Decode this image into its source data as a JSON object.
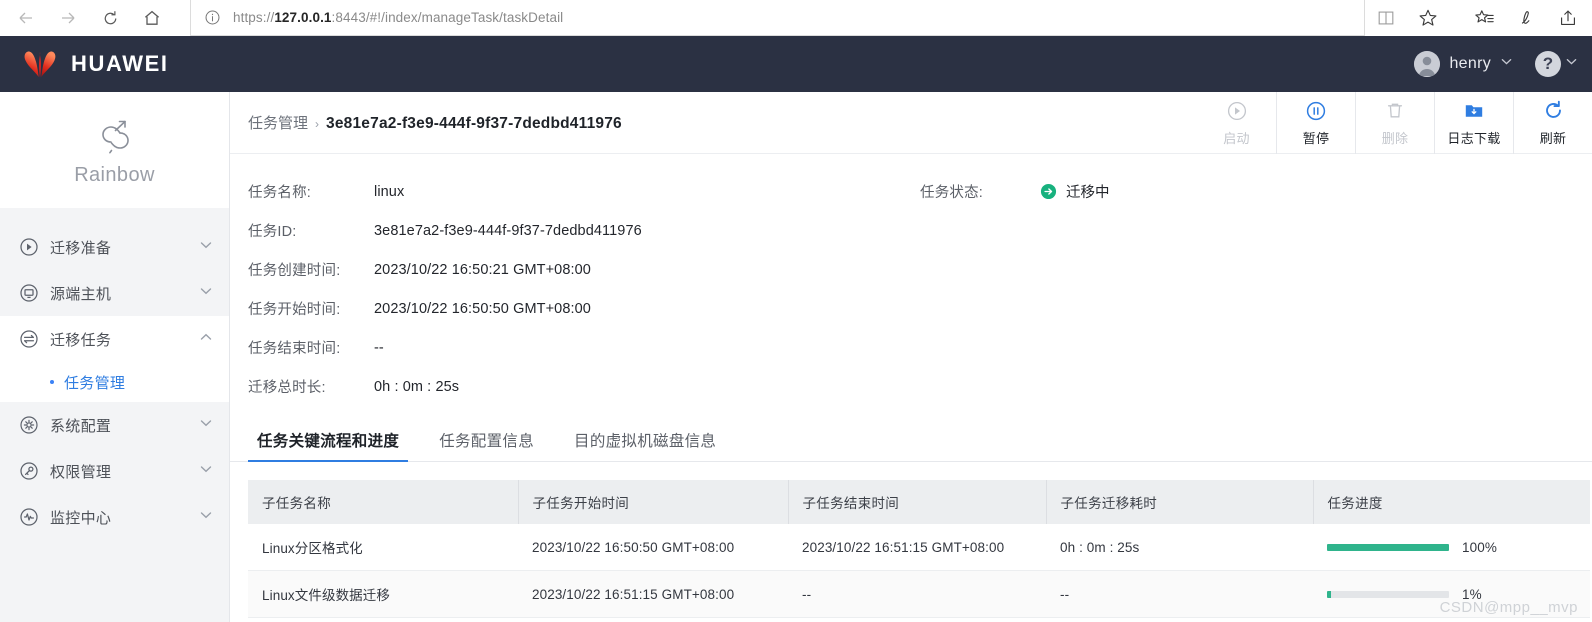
{
  "browser": {
    "nav": [
      {
        "name": "back",
        "icon": "arrow-left-icon",
        "enabled": false
      },
      {
        "name": "forward",
        "icon": "arrow-right-icon",
        "enabled": false
      },
      {
        "name": "refresh",
        "icon": "reload-icon",
        "enabled": true
      },
      {
        "name": "home",
        "icon": "home-icon",
        "enabled": true
      }
    ],
    "url_scheme": "https://",
    "url_host": "127.0.0.1",
    "url_path": ":8443/#!/index/manageTask/taskDetail",
    "url_full": "https://127.0.0.1:8443/#!/index/manageTask/taskDetail",
    "toolbar_icons": [
      "reading-view-icon",
      "favorite-star-icon",
      "reading-list-icon",
      "ink-pen-icon",
      "share-icon"
    ]
  },
  "header": {
    "brand": "HUAWEI",
    "user": "henry",
    "help_label": "?"
  },
  "sidebar": {
    "product": "Rainbow",
    "items": [
      {
        "label": "迁移准备",
        "icon": "play-circle-icon",
        "expanded": false
      },
      {
        "label": "源端主机",
        "icon": "monitor-circle-icon",
        "expanded": false
      },
      {
        "label": "迁移任务",
        "icon": "transfer-circle-icon",
        "expanded": true,
        "children": [
          {
            "label": "任务管理",
            "active": true
          }
        ]
      },
      {
        "label": "系统配置",
        "icon": "gear-circle-icon",
        "expanded": false
      },
      {
        "label": "权限管理",
        "icon": "key-circle-icon",
        "expanded": false
      },
      {
        "label": "监控中心",
        "icon": "pulse-circle-icon",
        "expanded": false
      }
    ]
  },
  "breadcrumb": {
    "parent": "任务管理",
    "separator": "›",
    "current": "3e81e7a2-f3e9-444f-9f37-7dedbd411976"
  },
  "actions": [
    {
      "label": "启动",
      "icon": "play-circle-icon",
      "enabled": false
    },
    {
      "label": "暂停",
      "icon": "pause-circle-icon",
      "enabled": true
    },
    {
      "label": "删除",
      "icon": "trash-icon",
      "enabled": false
    },
    {
      "label": "日志下载",
      "icon": "folder-download-icon",
      "enabled": true
    },
    {
      "label": "刷新",
      "icon": "refresh-icon",
      "enabled": true
    }
  ],
  "detail": {
    "fields": [
      {
        "label": "任务名称:",
        "value": "linux"
      },
      {
        "label": "任务ID:",
        "value": "3e81e7a2-f3e9-444f-9f37-7dedbd411976"
      },
      {
        "label": "任务创建时间:",
        "value": "2023/10/22 16:50:21 GMT+08:00"
      },
      {
        "label": "任务开始时间:",
        "value": "2023/10/22 16:50:50 GMT+08:00"
      },
      {
        "label": "任务结束时间:",
        "value": "--"
      },
      {
        "label": "迁移总时长:",
        "value": "0h : 0m : 25s"
      }
    ],
    "status_label": "任务状态:",
    "status_value": "迁移中",
    "status_color": "#18b17e"
  },
  "tabs": [
    {
      "label": "任务关键流程和进度",
      "active": true
    },
    {
      "label": "任务配置信息",
      "active": false
    },
    {
      "label": "目的虚拟机磁盘信息",
      "active": false
    }
  ],
  "table": {
    "columns": [
      "子任务名称",
      "子任务开始时间",
      "子任务结束时间",
      "子任务迁移耗时",
      "任务进度"
    ],
    "rows": [
      {
        "name": "Linux分区格式化",
        "start": "2023/10/22 16:50:50 GMT+08:00",
        "end": "2023/10/22 16:51:15 GMT+08:00",
        "elapsed": "0h : 0m : 25s",
        "progress": 100,
        "progress_label": "100%"
      },
      {
        "name": "Linux文件级数据迁移",
        "start": "2023/10/22 16:51:15 GMT+08:00",
        "end": "--",
        "elapsed": "--",
        "progress": 1,
        "progress_label": "1%"
      }
    ]
  },
  "watermark": "CSDN@mpp__mvp",
  "colors": {
    "header_bg": "#2b3143",
    "accent_blue": "#2f7de1",
    "progress_green": "#2fb48c",
    "sidebar_bg": "#f3f4f6"
  }
}
